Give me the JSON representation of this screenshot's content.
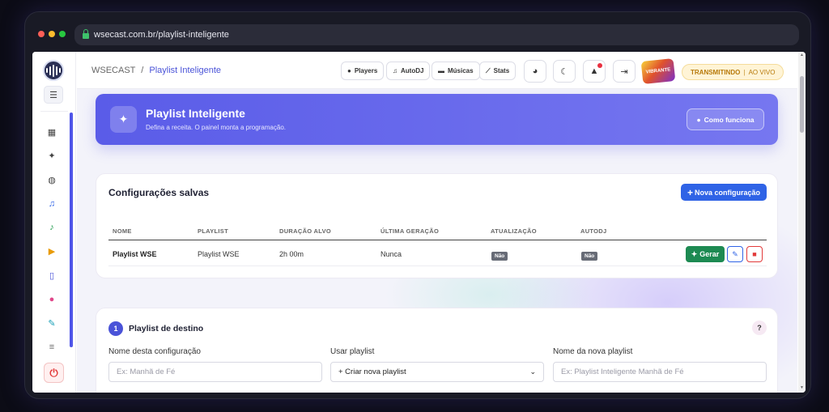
{
  "browser": {
    "url": "wsecast.com.br/playlist-inteligente",
    "dot_colors": [
      "#ff5f57",
      "#febc2e",
      "#28c840"
    ]
  },
  "sidebar": {
    "logo_text": "WSECAST",
    "items": [
      {
        "name": "dashboard-icon",
        "glyph": "▦",
        "color": "#444"
      },
      {
        "name": "magic-wand-icon",
        "glyph": "✦",
        "color": "#444"
      },
      {
        "name": "globe-icon",
        "glyph": "◍",
        "color": "#444"
      },
      {
        "name": "headphones-icon",
        "glyph": "♫",
        "color": "#2f63e6"
      },
      {
        "name": "music-icon",
        "glyph": "♪",
        "color": "#1d9a4a"
      },
      {
        "name": "play-circle-icon",
        "glyph": "▶",
        "color": "#e89b0a"
      },
      {
        "name": "mobile-icon",
        "glyph": "▯",
        "color": "#4a53d8"
      },
      {
        "name": "users-icon",
        "glyph": "●",
        "color": "#e0478a"
      },
      {
        "name": "wrench-icon",
        "glyph": "✎",
        "color": "#1aa0b8"
      },
      {
        "name": "more-icon",
        "glyph": "≡",
        "color": "#666"
      }
    ]
  },
  "topbar": {
    "breadcrumb_root": "WSECAST",
    "breadcrumb_sep": "/",
    "breadcrumb_current": "Playlist Inteligente",
    "pills": [
      {
        "name": "players-button",
        "icon": "play-circle-icon",
        "glyph": "●",
        "label": "Players"
      },
      {
        "name": "autodj-button",
        "icon": "music-icon",
        "glyph": "♫",
        "label": "AutoDJ"
      },
      {
        "name": "musicas-button",
        "icon": "folder-icon",
        "glyph": "▬",
        "label": "Músicas"
      },
      {
        "name": "stats-button",
        "icon": "chart-icon",
        "glyph": "⟋",
        "label": "Stats"
      }
    ],
    "avatar_text": "VIBRANTE",
    "live_status": "TRANSMITINDO",
    "live_sep": "|",
    "live_sub": "AO VIVO",
    "live_color": "#b7790a"
  },
  "hero": {
    "title": "Playlist Inteligente",
    "subtitle": "Defina a receita. O painel monta a programação.",
    "how_label": "Como funciona"
  },
  "saved": {
    "title": "Configurações salvas",
    "new_label": "Nova configuração",
    "headers": [
      "NOME",
      "PLAYLIST",
      "DURAÇÃO ALVO",
      "ÚLTIMA GERAÇÃO",
      "ATUALIZAÇÃO",
      "AUTODJ"
    ],
    "rows": [
      {
        "nome": "Playlist WSE",
        "playlist": "Playlist WSE",
        "duracao": "2h 00m",
        "ultima": "Nunca",
        "atualizacao": "Não",
        "autodj": "Não"
      }
    ],
    "gerar_label": "Gerar"
  },
  "destino": {
    "step": "1",
    "title": "Playlist de destino",
    "help": "?",
    "config_label": "Nome desta configuração",
    "config_placeholder": "Ex: Manhã de Fé",
    "usar_label": "Usar playlist",
    "usar_value": "+ Criar nova playlist",
    "nova_label": "Nome da nova playlist",
    "nova_placeholder": "Ex: Playlist Inteligente Manhã de Fé"
  },
  "colors": {
    "accent": "#5a5ce8",
    "primary_button": "#2f63e6",
    "success": "#1d8a52",
    "danger": "#e23a3a"
  }
}
